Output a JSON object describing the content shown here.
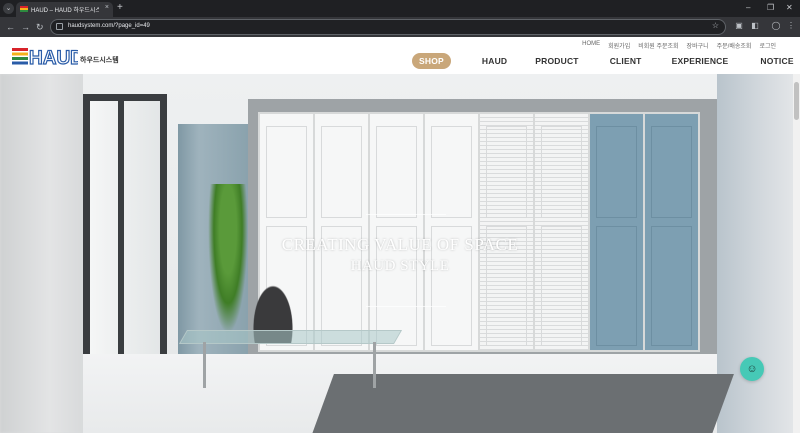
{
  "browser": {
    "tab_title": "HAUD – HAUD 하우드시스템",
    "new_tab": "+",
    "url": "haudsystem.com/?page_id=49",
    "tab_close": "×",
    "win_minimize": "–",
    "win_restore": "❐",
    "win_close": "✕"
  },
  "header": {
    "logo_wordmark": "HAUD",
    "logo_subtitle": "하우드시스템",
    "util_links": [
      "HOME",
      "회원가입",
      "비회원 주문조회",
      "장바구니",
      "주문/배송조회",
      "로그인"
    ],
    "nav": [
      "SHOP",
      "HAUD",
      "PRODUCT",
      "CLIENT",
      "EXPERIENCE",
      "NOTICE"
    ]
  },
  "hero": {
    "line1": "CREATING VALUE OF SPACE",
    "line2": "HAUD STYLE"
  },
  "icons": {
    "tab_menu": "chevron-down-icon",
    "back": "arrow-left-icon",
    "forward": "arrow-right-icon",
    "reload": "reload-icon",
    "site_info": "site-info-icon",
    "bookmark": "star-icon",
    "chat": "chat-icon"
  },
  "colors": {
    "shop_pill": "#c9a77a",
    "chat_button": "#46c9b6",
    "chrome_dark": "#35363a"
  }
}
